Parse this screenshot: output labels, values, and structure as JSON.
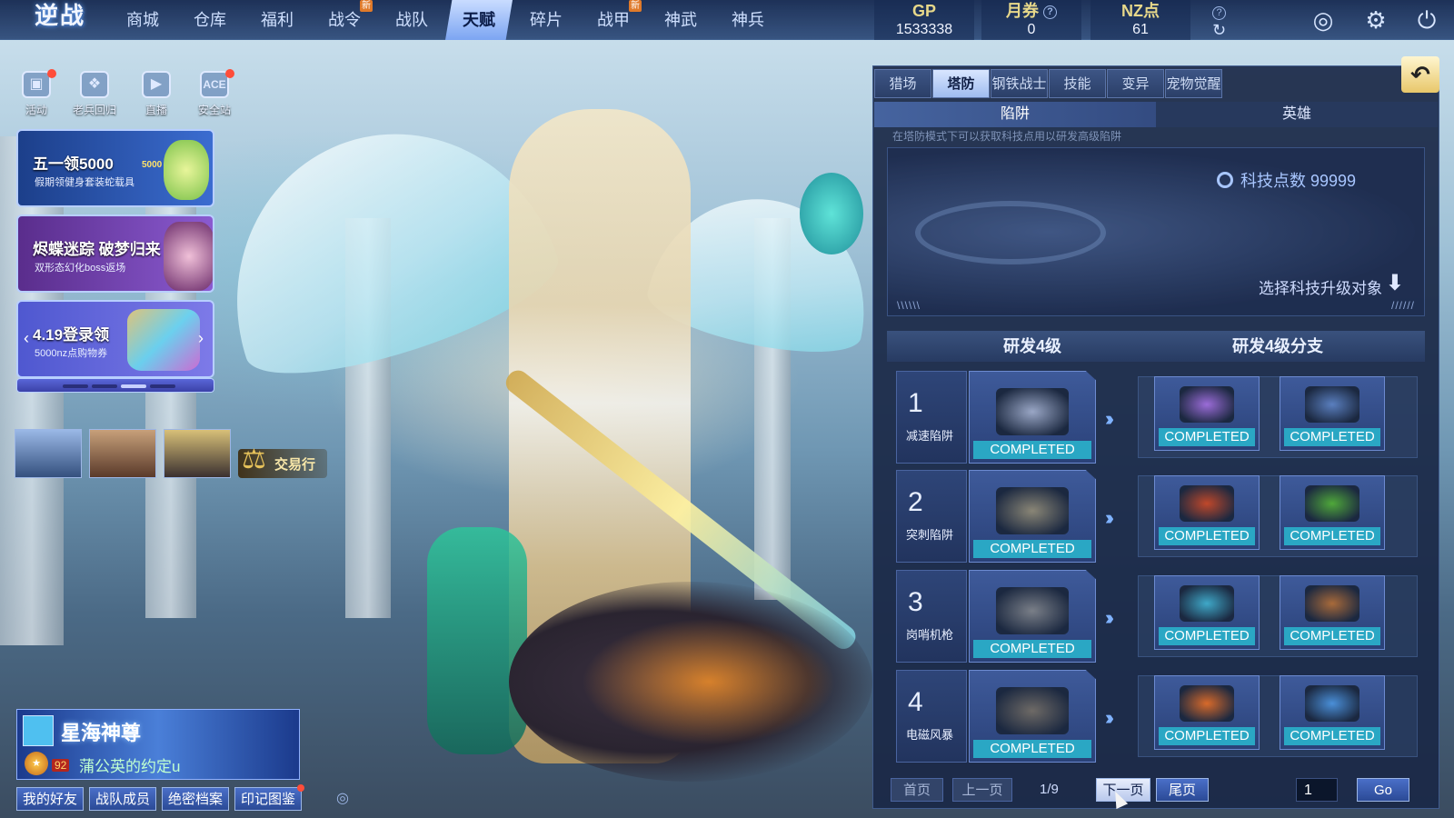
{
  "game": {
    "logo_text": "逆战"
  },
  "nav": {
    "items": [
      {
        "label": "商城",
        "badge": ""
      },
      {
        "label": "仓库",
        "badge": ""
      },
      {
        "label": "福利",
        "badge": ""
      },
      {
        "label": "战令",
        "badge": "新"
      },
      {
        "label": "战队",
        "badge": ""
      },
      {
        "label": "天赋",
        "badge": "",
        "active": true
      },
      {
        "label": "碎片",
        "badge": ""
      },
      {
        "label": "战甲",
        "badge": "新"
      },
      {
        "label": "神武",
        "badge": ""
      },
      {
        "label": "神兵",
        "badge": ""
      }
    ]
  },
  "currency": {
    "gp": {
      "name": "GP",
      "value": "1533338"
    },
    "monthly": {
      "name": "月券",
      "value": "0"
    },
    "nz": {
      "name": "NZ点",
      "value": "61"
    }
  },
  "top_icons": [
    "planet-icon",
    "gear-icon",
    "power-icon"
  ],
  "left": {
    "quick_icons": [
      {
        "label": "活动",
        "icon": "gift-icon",
        "dot": true
      },
      {
        "label": "老兵回归",
        "icon": "emblem-icon",
        "dot": false
      },
      {
        "label": "直播",
        "icon": "tv-icon",
        "dot": false
      },
      {
        "label": "安全站",
        "icon": "ace-icon",
        "dot": true
      }
    ],
    "banners": [
      {
        "title": "五一领5000",
        "subtitle": "假期领健身套装蛇载具",
        "extra": "5000"
      },
      {
        "title": "烬蝶迷踪 破梦归来",
        "subtitle": "双形态幻化boss返场"
      },
      {
        "title": "4.19登录领",
        "subtitle": "5000nz点购物券"
      }
    ],
    "trade_label": "交易行",
    "title_card": {
      "title": "星海神尊",
      "level": "92",
      "player_name": "蒲公英的约定u"
    },
    "bottom_buttons": [
      {
        "label": "我的好友",
        "dot": false
      },
      {
        "label": "战队成员",
        "dot": false
      },
      {
        "label": "绝密档案",
        "dot": false
      },
      {
        "label": "印记图鉴",
        "dot": true
      }
    ]
  },
  "panel": {
    "tabs": [
      {
        "label": "猎场",
        "active": false
      },
      {
        "label": "塔防",
        "active": true
      },
      {
        "label": "钢铁战士",
        "active": false
      },
      {
        "label": "技能",
        "active": false
      },
      {
        "label": "变异",
        "active": false
      },
      {
        "label": "宠物觉醒",
        "active": false
      }
    ],
    "subtabs": [
      {
        "label": "陷阱",
        "active": true
      },
      {
        "label": "英雄",
        "active": false
      }
    ],
    "hint": "在塔防模式下可以获取科技点用以研发高级陷阱",
    "tech_points_label": "科技点数 99999",
    "select_hint": "选择科技升级对象",
    "grid_headers": [
      "研发4级",
      "研发4级分支"
    ],
    "rows": [
      {
        "num": "1",
        "name": "减速陷阱",
        "main_status": "COMPLETED",
        "branch_status": [
          "COMPLETED",
          "COMPLETED"
        ],
        "colors": {
          "main": "#9aa7c6",
          "b1": "#9b6cd8",
          "b2": "#5a7fbf"
        }
      },
      {
        "num": "2",
        "name": "突刺陷阱",
        "main_status": "COMPLETED",
        "branch_status": [
          "COMPLETED",
          "COMPLETED"
        ],
        "colors": {
          "main": "#8a8676",
          "b1": "#c0482a",
          "b2": "#4fa83a"
        }
      },
      {
        "num": "3",
        "name": "岗哨机枪",
        "main_status": "COMPLETED",
        "branch_status": [
          "COMPLETED",
          "COMPLETED"
        ],
        "colors": {
          "main": "#7a7f88",
          "b1": "#3fa8c8",
          "b2": "#a86a3a"
        }
      },
      {
        "num": "4",
        "name": "电磁风暴",
        "main_status": "COMPLETED",
        "branch_status": [
          "COMPLETED",
          "COMPLETED"
        ],
        "colors": {
          "main": "#6e6a66",
          "b1": "#d86a2a",
          "b2": "#4a8fd8"
        }
      }
    ],
    "pagination": {
      "first": "首页",
      "prev": "上一页",
      "page_info": "1/9",
      "next": "下一页",
      "last": "尾页",
      "input_value": "1",
      "go": "Go"
    }
  },
  "colors": {
    "accent": "#2aa7c4",
    "panel": "#1a2846",
    "active_tab": "#c9dcff"
  }
}
